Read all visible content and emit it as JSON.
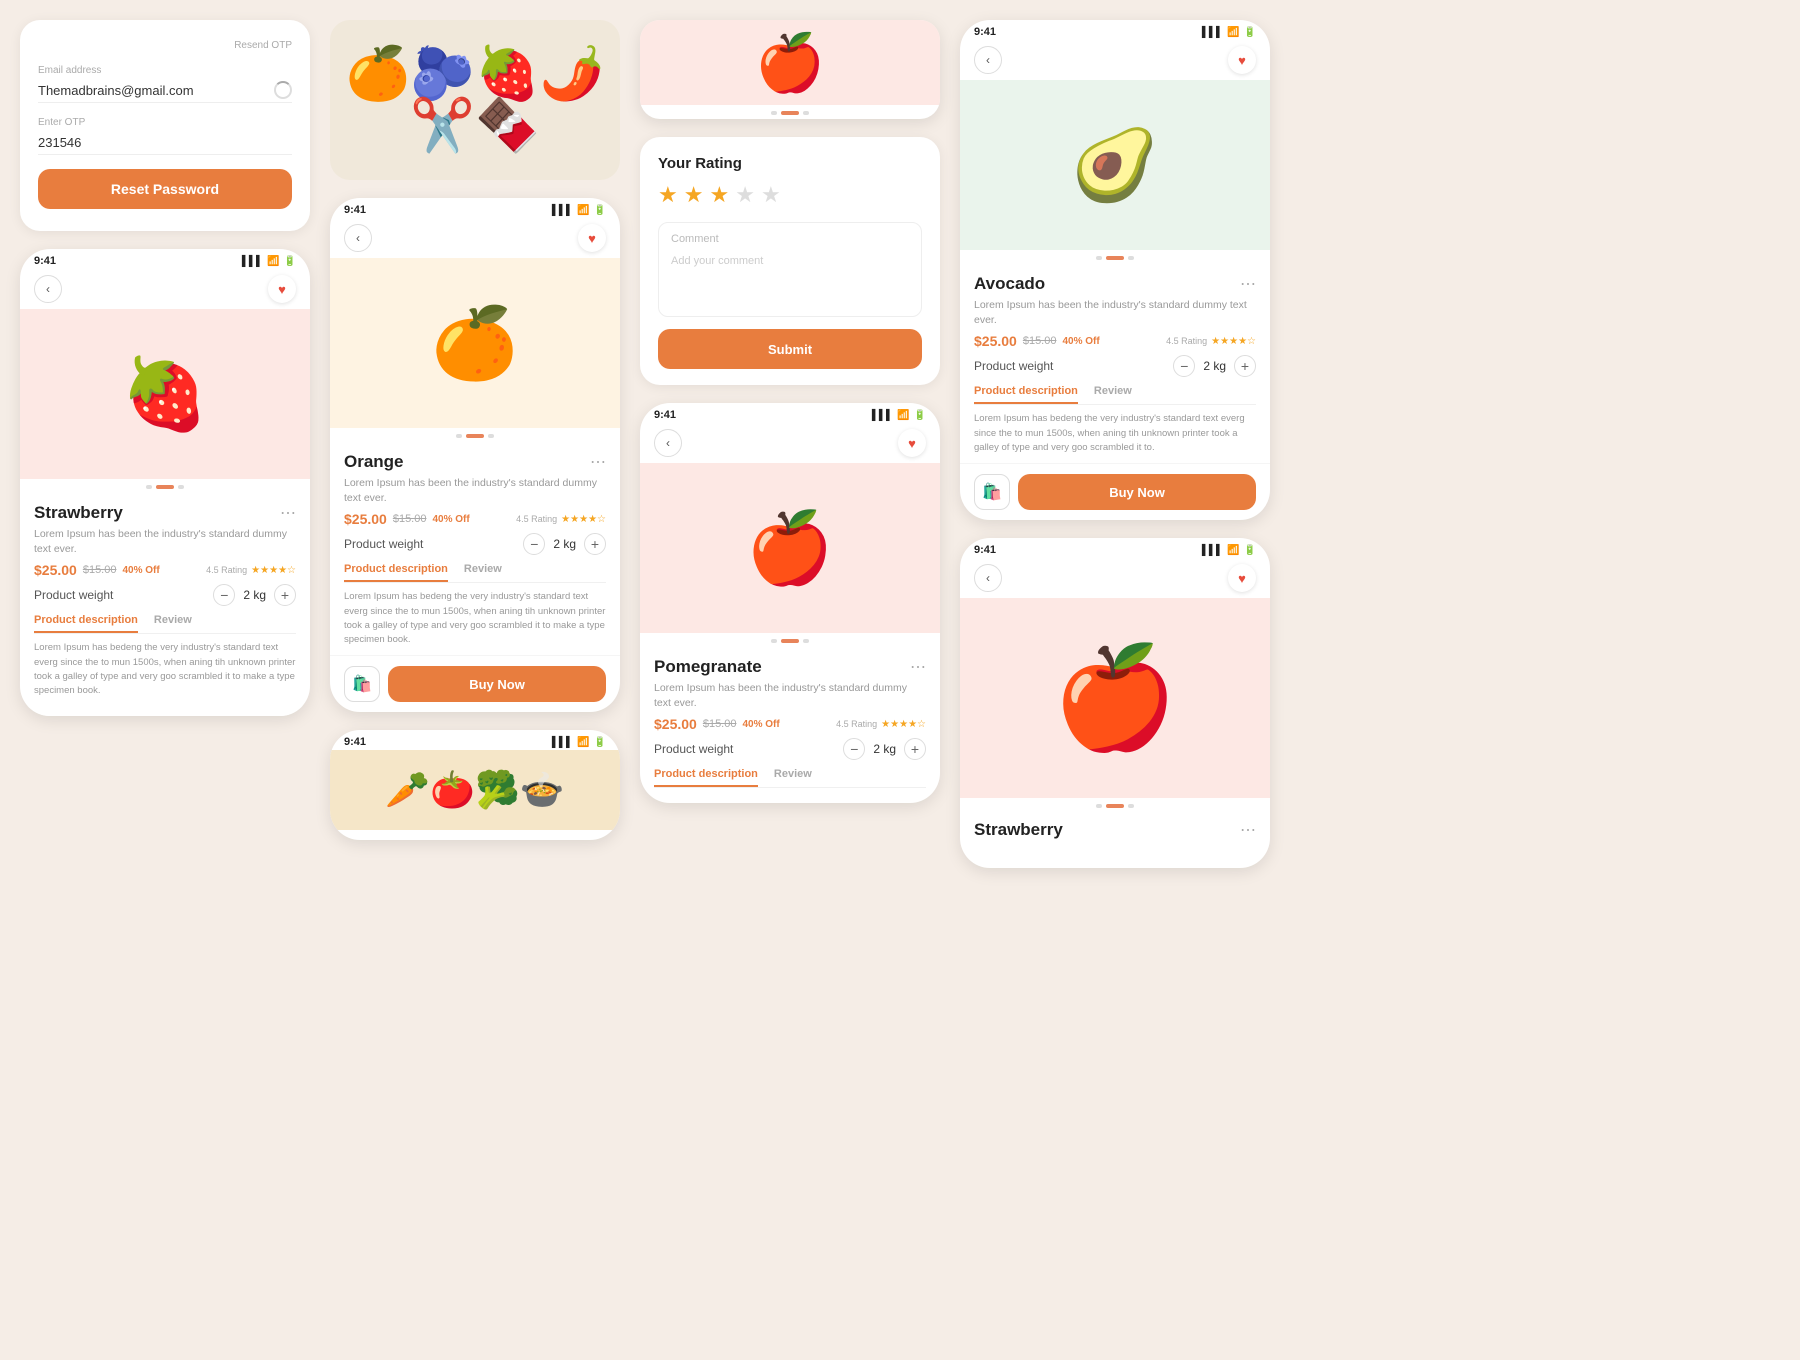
{
  "colors": {
    "orange": "#e87d3e",
    "light_orange_bg": "#fef3e2",
    "light_pink_bg": "#fde8e4",
    "light_green_bg": "#eaf4ec",
    "star_color": "#f5a623",
    "text_dark": "#222222",
    "text_mid": "#555555",
    "text_light": "#999999",
    "white": "#ffffff"
  },
  "login": {
    "resend_label": "Resend OTP",
    "email_label": "Email address",
    "email_value": "Themadbrains@gmail.com",
    "otp_label": "Enter OTP",
    "otp_value": "231546",
    "reset_btn": "Reset Password"
  },
  "strawberry_product": {
    "status_time": "9:41",
    "name": "Strawberry",
    "desc": "Lorem Ipsum has been the industry's standard dummy text ever.",
    "price_current": "$25.00",
    "price_original": "$15.00",
    "discount": "40% Off",
    "rating_label": "4.5 Rating",
    "stars_filled": 4,
    "stars_total": 5,
    "weight_label": "Product weight",
    "weight_value": "2 kg",
    "tab_active": "Product description",
    "tab_inactive": "Review",
    "long_desc": "Lorem Ipsum has bedeng the very industry's standard text everg since the to mun 1500s, when aning tih unknown printer took a galley of type and very goo scrambled it to make a type specimen book.",
    "carousel_active": 1,
    "carousel_dots": 3
  },
  "orange_product": {
    "status_time": "9:41",
    "name": "Orange",
    "desc": "Lorem Ipsum has been the industry's standard dummy text ever.",
    "price_current": "$25.00",
    "price_original": "$15.00",
    "discount": "40% Off",
    "rating_label": "4.5 Rating",
    "stars_filled": 4,
    "stars_total": 5,
    "weight_label": "Product weight",
    "weight_value": "2 kg",
    "tab_active": "Product description",
    "tab_inactive": "Review",
    "long_desc": "Lorem Ipsum has bedeng the very industry's standard text everg since the to mun 1500s, when aning tih unknown printer took a galley of type and very goo scrambled it to make a type specimen book.",
    "buy_btn": "Buy Now",
    "carousel_active": 1,
    "carousel_dots": 3
  },
  "rating_screen": {
    "title": "Your Rating",
    "stars_filled": 3,
    "stars_total": 5,
    "comment_label": "Comment",
    "comment_placeholder": "Add your comment",
    "submit_btn": "Submit"
  },
  "pomegranate_product": {
    "status_time": "9:41",
    "name": "Pomegranate",
    "desc": "Lorem Ipsum has been the industry's standard dummy text ever.",
    "price_current": "$25.00",
    "price_original": "$15.00",
    "discount": "40% Off",
    "rating_label": "4.5 Rating",
    "stars_filled": 4,
    "stars_total": 5,
    "weight_label": "Product weight",
    "weight_value": "2 kg",
    "tab_active": "Product description",
    "tab_inactive": "Review",
    "carousel_active": 1,
    "carousel_dots": 3
  },
  "avocado_product": {
    "status_time": "9:41",
    "name": "Avocado",
    "desc": "Lorem Ipsum has been the industry's standard dummy text ever.",
    "price_current": "$25.00",
    "price_original": "$15.00",
    "discount": "40% Off",
    "rating_label": "4.5 Rating",
    "stars_filled": 4,
    "stars_total": 5,
    "weight_label": "Product weight",
    "weight_value": "2 kg",
    "tab_active": "Product description",
    "tab_inactive": "Review",
    "long_desc": "Lorem Ipsum has bedeng the very industry's standard text everg since the to mun 1500s, when aning tih unknown printer took a galley of type and very goo scrambled it to.",
    "buy_btn": "Buy Now",
    "carousel_active": 1,
    "carousel_dots": 3
  },
  "strawberry2_product": {
    "status_time": "9:41",
    "name": "Strawberry",
    "carousel_active": 1,
    "carousel_dots": 3
  },
  "food_collage": {
    "status_time": "9:41"
  }
}
